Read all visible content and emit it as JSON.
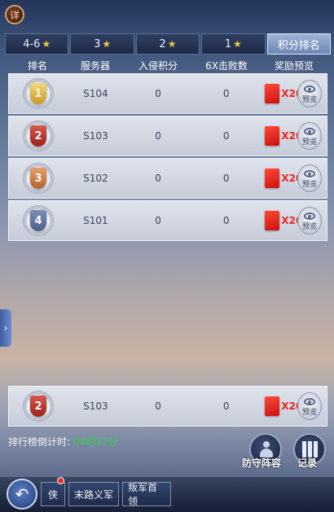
{
  "detail_button": "详",
  "tabs": [
    {
      "label": "4-6",
      "star": "★",
      "active": false
    },
    {
      "label": "3",
      "star": "★",
      "active": false
    },
    {
      "label": "2",
      "star": "★",
      "active": false
    },
    {
      "label": "1",
      "star": "★",
      "active": false
    },
    {
      "label": "积分排名",
      "star": "",
      "active": true
    }
  ],
  "table": {
    "headers": [
      "排名",
      "服务器",
      "入侵积分",
      "6X击败数",
      "奖励预览"
    ],
    "rows": [
      {
        "rank": "1",
        "server": "S104",
        "invade": "0",
        "kills": "0",
        "reward_qty": "X20",
        "preview": "预览",
        "badge": "gold"
      },
      {
        "rank": "2",
        "server": "S103",
        "invade": "0",
        "kills": "0",
        "reward_qty": "X20",
        "preview": "预览",
        "badge": "red"
      },
      {
        "rank": "3",
        "server": "S102",
        "invade": "0",
        "kills": "0",
        "reward_qty": "X20",
        "preview": "预览",
        "badge": "bronze"
      },
      {
        "rank": "4",
        "server": "S101",
        "invade": "0",
        "kills": "0",
        "reward_qty": "X20",
        "preview": "预览",
        "badge": "blue"
      }
    ]
  },
  "my_row": {
    "rank": "2",
    "server": "S103",
    "invade": "0",
    "kills": "0",
    "reward_qty": "X20",
    "preview": "预览",
    "badge": "red"
  },
  "countdown": {
    "label": "排行榜倒计时: ",
    "time": "04时27分"
  },
  "side_buttons": {
    "lineup": "防守阵容",
    "records": "记录"
  },
  "bottom_tabs": [
    "侠",
    "末路义军",
    "叛军首领"
  ],
  "colors": {
    "accent_green": "#2fd34a",
    "reward_red": "#e22a22"
  }
}
